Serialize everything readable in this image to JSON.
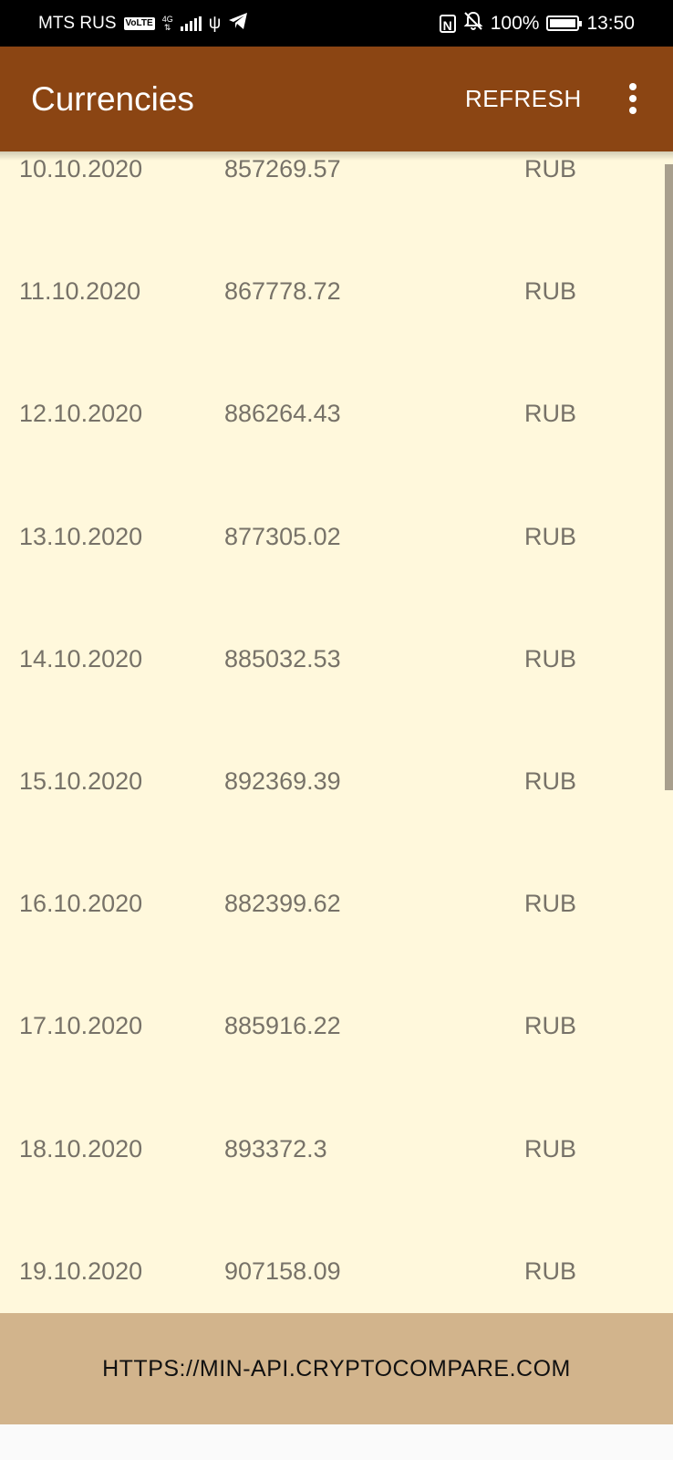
{
  "status_bar": {
    "carrier": "MTS RUS",
    "volte": "VoLTE",
    "network": "4G",
    "battery": "100%",
    "time": "13:50"
  },
  "app_bar": {
    "title": "Currencies",
    "refresh_label": "REFRESH"
  },
  "rates": [
    {
      "date": "10.10.2020",
      "price": "857269.57",
      "currency": "RUB"
    },
    {
      "date": "11.10.2020",
      "price": "867778.72",
      "currency": "RUB"
    },
    {
      "date": "12.10.2020",
      "price": "886264.43",
      "currency": "RUB"
    },
    {
      "date": "13.10.2020",
      "price": "877305.02",
      "currency": "RUB"
    },
    {
      "date": "14.10.2020",
      "price": "885032.53",
      "currency": "RUB"
    },
    {
      "date": "15.10.2020",
      "price": "892369.39",
      "currency": "RUB"
    },
    {
      "date": "16.10.2020",
      "price": "882399.62",
      "currency": "RUB"
    },
    {
      "date": "17.10.2020",
      "price": "885916.22",
      "currency": "RUB"
    },
    {
      "date": "18.10.2020",
      "price": "893372.3",
      "currency": "RUB"
    },
    {
      "date": "19.10.2020",
      "price": "907158.09",
      "currency": "RUB"
    }
  ],
  "footer": {
    "link": "HTTPS://MIN-API.CRYPTOCOMPARE.COM"
  },
  "colors": {
    "app_bar": "#8b4513",
    "list_background": "#fff8dc",
    "footer": "#d2b48c"
  }
}
